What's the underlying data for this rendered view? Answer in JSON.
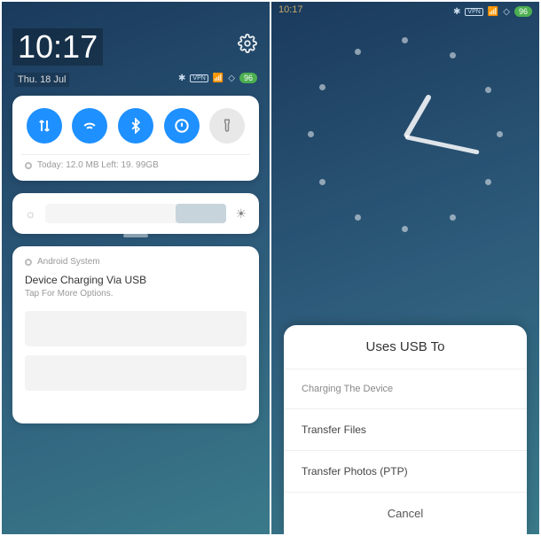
{
  "left": {
    "status_time": "10:17",
    "big_time": "10:17",
    "date": "Thu. 18 Jul",
    "battery": "96",
    "toggles": {
      "data": true,
      "wifi": true,
      "bluetooth": true,
      "dnd": true,
      "flashlight": false
    },
    "data_usage": "Today: 12.0 MB Left: 19. 99GB",
    "brightness_pct": 72,
    "notification": {
      "source": "Android System",
      "title": "Device Charging Via USB",
      "subtitle": "Tap For More Options."
    }
  },
  "right": {
    "status_time": "10:17",
    "battery": "96",
    "sheet": {
      "title": "Uses USB To",
      "items": [
        "Charging The Device",
        "Transfer Files",
        "Transfer Photos (PTP)"
      ],
      "cancel": "Cancel"
    }
  }
}
